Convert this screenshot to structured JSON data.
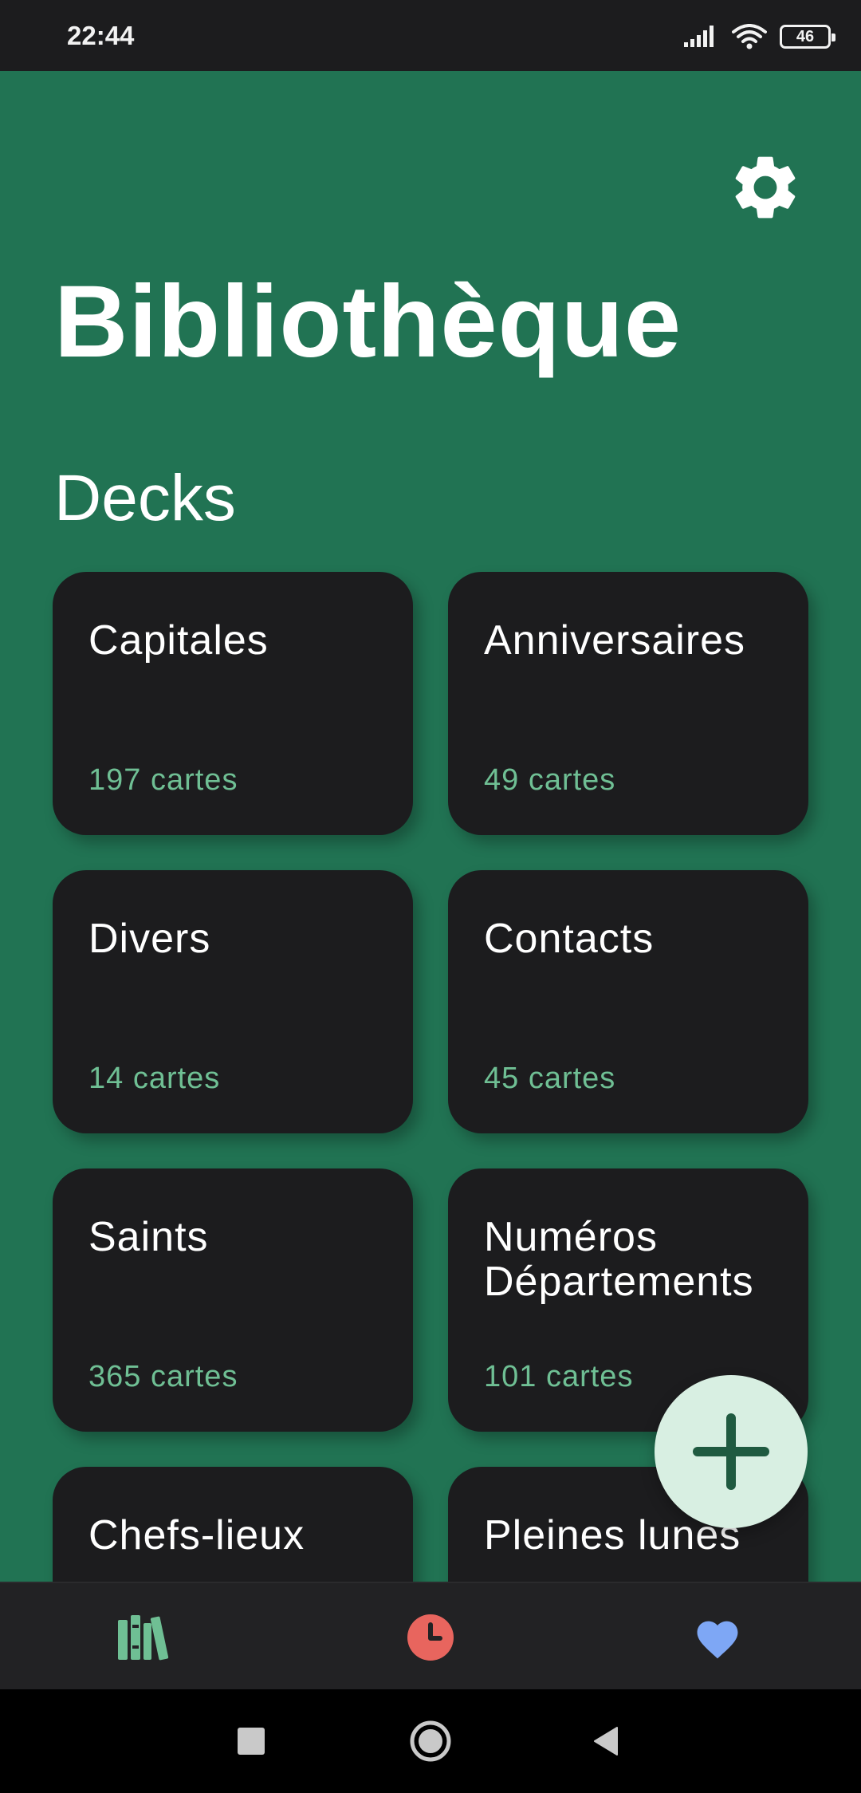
{
  "status_bar": {
    "time": "22:44",
    "battery": "46"
  },
  "header": {
    "title": "Bibliothèque",
    "settings_icon": "gear-icon"
  },
  "section": {
    "title": "Decks"
  },
  "decks": [
    {
      "name": "Capitales",
      "count": "197 cartes"
    },
    {
      "name": "Anniversaires",
      "count": "49 cartes"
    },
    {
      "name": "Divers",
      "count": "14 cartes"
    },
    {
      "name": "Contacts",
      "count": "45 cartes"
    },
    {
      "name": "Saints",
      "count": "365 cartes"
    },
    {
      "name": "Numéros Départements",
      "count": "101 cartes"
    },
    {
      "name": "Chefs-lieux",
      "count": ""
    },
    {
      "name": "Pleines lunes",
      "count": ""
    }
  ],
  "fab": {
    "icon": "plus-icon"
  },
  "bottom_nav": {
    "items": [
      {
        "icon": "library-icon",
        "color": "#6fbf94"
      },
      {
        "icon": "clock-icon",
        "color": "#e8655e"
      },
      {
        "icon": "heart-icon",
        "color": "#7ea7f5"
      }
    ]
  },
  "colors": {
    "background": "#217353",
    "card": "#1c1c1e",
    "accent_text": "#6fbf94",
    "fab": "#d8efe2",
    "fab_icon": "#1f5a40"
  }
}
